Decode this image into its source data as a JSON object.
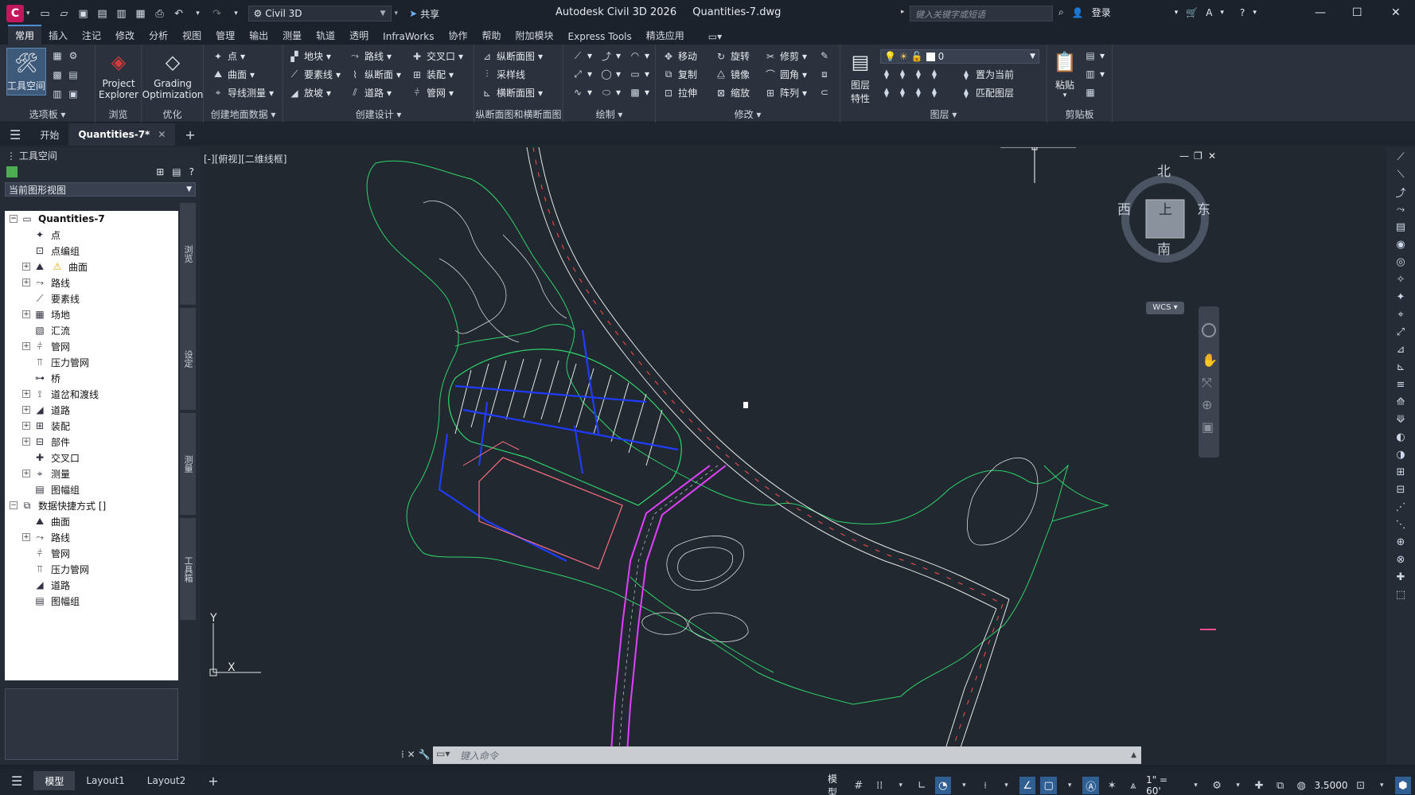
{
  "titlebar": {
    "app_letter": "C",
    "workspace": "Civil 3D",
    "share": "共享",
    "app_title": "Autodesk Civil 3D 2026",
    "doc_title": "Quantities-7.dwg",
    "search_placeholder": "键入关键字或短语",
    "signin": "登录"
  },
  "ribbon_tabs": [
    "常用",
    "插入",
    "注记",
    "修改",
    "分析",
    "视图",
    "管理",
    "输出",
    "测量",
    "轨道",
    "透明",
    "InfraWorks",
    "协作",
    "帮助",
    "附加模块",
    "Express Tools",
    "精选应用"
  ],
  "ribbon": {
    "palettes": {
      "label": "选项板",
      "toolspace": "工具空间"
    },
    "browse": {
      "label": "浏览",
      "project_explorer_1": "Project",
      "project_explorer_2": "Explorer"
    },
    "optimize": {
      "label": "优化",
      "grading_1": "Grading",
      "grading_2": "Optimization"
    },
    "ground": {
      "label": "创建地面数据",
      "point": "点",
      "surface": "曲面",
      "traverse": "导线测量"
    },
    "design": {
      "label": "创建设计",
      "parcel": "地块",
      "feature_line": "要素线",
      "grading": "放坡",
      "alignment": "路线",
      "profile": "纵断面",
      "corridor": "道路",
      "intersection": "交叉口",
      "assembly": "装配",
      "pipe_network": "管网"
    },
    "profile_section": {
      "label": "纵断面图和横断面图",
      "profile_view": "纵断面图",
      "sample_line": "采样线",
      "section_view": "横断面图"
    },
    "draw": {
      "label": "绘制"
    },
    "modify": {
      "label": "修改",
      "move": "移动",
      "rotate": "旋转",
      "trim": "修剪",
      "copy": "复制",
      "mirror": "镜像",
      "fillet": "圆角",
      "stretch": "拉伸",
      "scale": "缩放",
      "array": "阵列"
    },
    "layers": {
      "label": "图层",
      "layer_props_1": "图层",
      "layer_props_2": "特性",
      "current_layer": "0",
      "make_current": "置为当前",
      "match_layer": "匹配图层"
    },
    "clipboard": {
      "label": "剪贴板",
      "paste": "粘贴"
    }
  },
  "filetabs": {
    "start": "开始",
    "doc": "Quantities-7*"
  },
  "toolspace": {
    "title": "工具空间",
    "view_select": "当前图形视图",
    "tree": [
      {
        "label": "Quantities-7",
        "level": 0,
        "exp": "-",
        "icon": "drawing-icon",
        "root": true
      },
      {
        "label": "点",
        "level": 1,
        "exp": "",
        "icon": "point-icon"
      },
      {
        "label": "点编组",
        "level": 1,
        "exp": "",
        "icon": "point-group-icon"
      },
      {
        "label": "曲面",
        "level": 1,
        "exp": "+",
        "icon": "surface-icon",
        "warn": true
      },
      {
        "label": "路线",
        "level": 1,
        "exp": "+",
        "icon": "alignment-icon"
      },
      {
        "label": "要素线",
        "level": 1,
        "exp": "",
        "icon": "feature-line-icon"
      },
      {
        "label": "场地",
        "level": 1,
        "exp": "+",
        "icon": "site-icon"
      },
      {
        "label": "汇流",
        "level": 1,
        "exp": "",
        "icon": "catchment-icon"
      },
      {
        "label": "管网",
        "level": 1,
        "exp": "+",
        "icon": "pipe-network-icon"
      },
      {
        "label": "压力管网",
        "level": 1,
        "exp": "",
        "icon": "pressure-network-icon"
      },
      {
        "label": "桥",
        "level": 1,
        "exp": "",
        "icon": "bridge-icon"
      },
      {
        "label": "道岔和渡线",
        "level": 1,
        "exp": "+",
        "icon": "turnout-icon"
      },
      {
        "label": "道路",
        "level": 1,
        "exp": "+",
        "icon": "corridor-icon"
      },
      {
        "label": "装配",
        "level": 1,
        "exp": "+",
        "icon": "assembly-icon"
      },
      {
        "label": "部件",
        "level": 1,
        "exp": "+",
        "icon": "subassembly-icon"
      },
      {
        "label": "交叉口",
        "level": 1,
        "exp": "",
        "icon": "intersection-icon"
      },
      {
        "label": "测量",
        "level": 1,
        "exp": "+",
        "icon": "survey-icon"
      },
      {
        "label": "图幅组",
        "level": 1,
        "exp": "",
        "icon": "view-frame-icon"
      },
      {
        "label": "数据快捷方式 []",
        "level": 0,
        "exp": "-",
        "icon": "data-shortcut-icon"
      },
      {
        "label": "曲面",
        "level": 1,
        "exp": "",
        "icon": "surface-icon"
      },
      {
        "label": "路线",
        "level": 1,
        "exp": "+",
        "icon": "alignment-icon"
      },
      {
        "label": "管网",
        "level": 1,
        "exp": "",
        "icon": "pipe-network-icon"
      },
      {
        "label": "压力管网",
        "level": 1,
        "exp": "",
        "icon": "pressure-network-icon"
      },
      {
        "label": "道路",
        "level": 1,
        "exp": "",
        "icon": "corridor-icon"
      },
      {
        "label": "图幅组",
        "level": 1,
        "exp": "",
        "icon": "view-frame-icon"
      }
    ],
    "vtabs": [
      "浏览",
      "设定",
      "测量",
      "工具箱"
    ]
  },
  "canvas": {
    "viewport_label": "[-][俯视][二维线框]",
    "viewcube": {
      "north": "北",
      "south": "南",
      "east": "东",
      "west": "西",
      "face": "上"
    },
    "wcs": "WCS",
    "ucs_y": "Y",
    "ucs_x": "X",
    "command_placeholder": "键入命令"
  },
  "statusbar": {
    "tabs": [
      "模型",
      "Layout1",
      "Layout2"
    ],
    "model_space": "模型",
    "scale": "1\" = 60'",
    "elevation": "3.5000"
  },
  "colors": {
    "accent": "#4f8fd6",
    "canvas_bg": "#212830",
    "boundary_green": "#2fd36b",
    "road_white": "#e6e6e6",
    "pipe_blue": "#1f3cff",
    "corridor_magenta": "#e040fb",
    "building_pink": "#ff6f7f"
  }
}
